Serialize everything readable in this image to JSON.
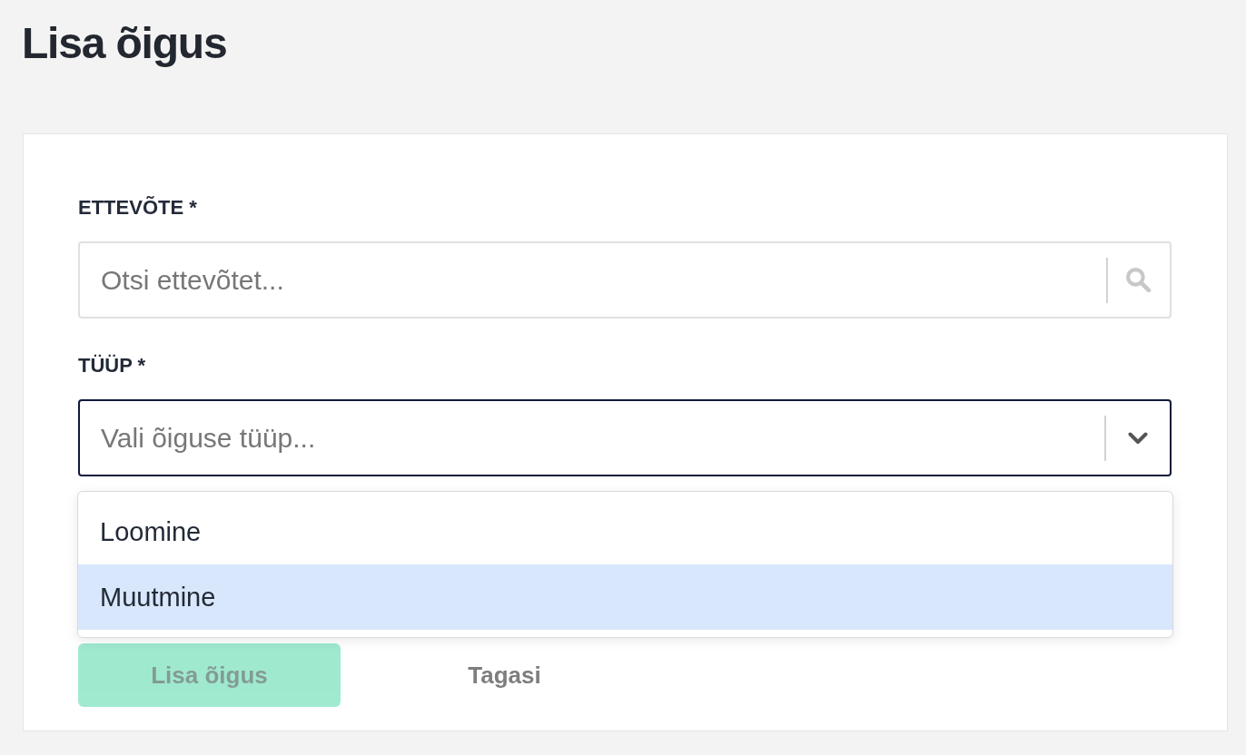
{
  "page": {
    "title": "Lisa õigus"
  },
  "form": {
    "fields": [
      {
        "kind": "search",
        "label": "ETTEVÕTE *",
        "placeholder": "Otsi ettevõtet...",
        "focused": false
      },
      {
        "kind": "select",
        "label": "TÜÜP *",
        "placeholder": "Vali õiguse tüüp...",
        "focused": true,
        "expanded": true,
        "options": [
          {
            "label": "Loomine",
            "selected": false
          },
          {
            "label": "Muutmine",
            "selected": true
          }
        ]
      }
    ],
    "buttons": [
      {
        "kind": "primary",
        "label": "Lisa õigus",
        "disabled": true
      },
      {
        "kind": "secondary",
        "label": "Tagasi",
        "disabled": false
      }
    ]
  }
}
